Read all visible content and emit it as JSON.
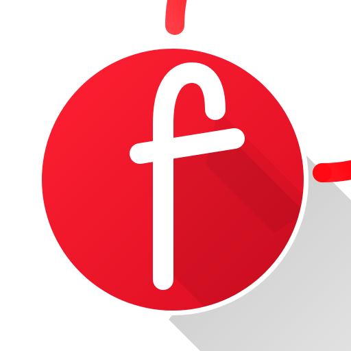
{
  "logo": {
    "letter": "f",
    "icon": "letter-f-logo-icon",
    "colors": {
      "background": "#ffffff",
      "disc_light": "#ff1f32",
      "disc_dark": "#dc0e22",
      "ring_light": "#ffd3d8",
      "ring_mid": "#ff7078",
      "ring_dark": "#ff0a14",
      "letter": "#ffffff",
      "shadow": "#c9c9c9"
    }
  }
}
